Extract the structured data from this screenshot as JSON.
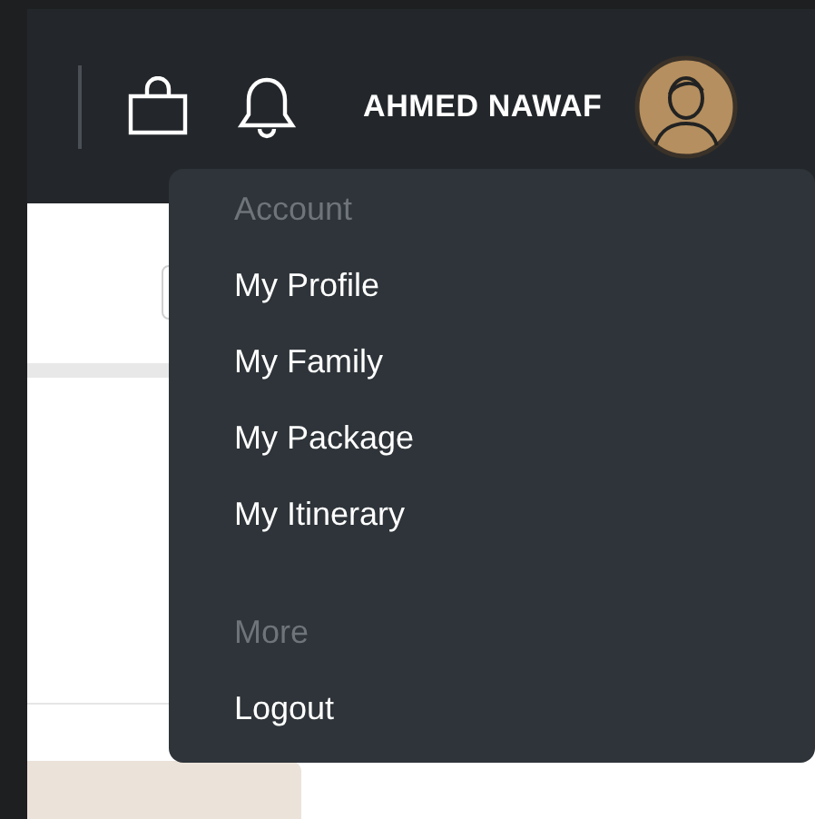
{
  "header": {
    "user_name": "AHMED NAWAF"
  },
  "user_menu": {
    "sections": [
      {
        "title": "Account",
        "items": [
          "My Profile",
          "My Family",
          "My Package",
          "My Itinerary"
        ]
      },
      {
        "title": "More",
        "items": [
          "Logout"
        ]
      }
    ]
  }
}
